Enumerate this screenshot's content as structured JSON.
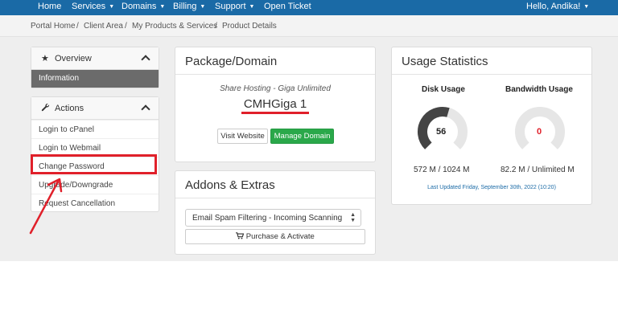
{
  "nav": {
    "items": [
      {
        "label": "Home",
        "dropdown": false
      },
      {
        "label": "Services",
        "dropdown": true
      },
      {
        "label": "Domains",
        "dropdown": true
      },
      {
        "label": "Billing",
        "dropdown": true
      },
      {
        "label": "Support",
        "dropdown": true
      },
      {
        "label": "Open Ticket",
        "dropdown": false
      }
    ],
    "user": "Hello, Andika!"
  },
  "breadcrumb": [
    "Portal Home",
    "Client Area",
    "My Products & Services",
    "Product Details"
  ],
  "sidebar": {
    "overview": {
      "title": "Overview",
      "active_item": "Information"
    },
    "actions": {
      "title": "Actions",
      "items": [
        "Login to cPanel",
        "Login to Webmail",
        "Change Password",
        "Upgrade/Downgrade",
        "Request Cancellation"
      ]
    }
  },
  "package": {
    "title": "Package/Domain",
    "product": "Share Hosting - Giga Unlimited",
    "name": "CMHGiga 1",
    "visit_label": "Visit Website",
    "manage_label": "Manage Domain"
  },
  "addons": {
    "title": "Addons & Extras",
    "selected": "Email Spam Filtering - Incoming Scanning",
    "purchase_label": "Purchase & Activate"
  },
  "usage": {
    "title": "Usage Statistics",
    "disk": {
      "label": "Disk Usage",
      "percent": 56,
      "value_text": "56",
      "summary": "572 M / 1024 M"
    },
    "bandwidth": {
      "label": "Bandwidth Usage",
      "percent": 0,
      "value_text": "0",
      "summary": "82.2 M / Unlimited M"
    },
    "updated": "Last Updated Friday, September 30th, 2022 (10:20)"
  },
  "colors": {
    "nav": "#1a6aa6",
    "success": "#2aa84a",
    "highlight": "#e0202a",
    "gauge_fill": "#444444",
    "gauge_track": "#e6e6e6",
    "zero_value": "#e0202a",
    "link": "#1a6aa6"
  }
}
